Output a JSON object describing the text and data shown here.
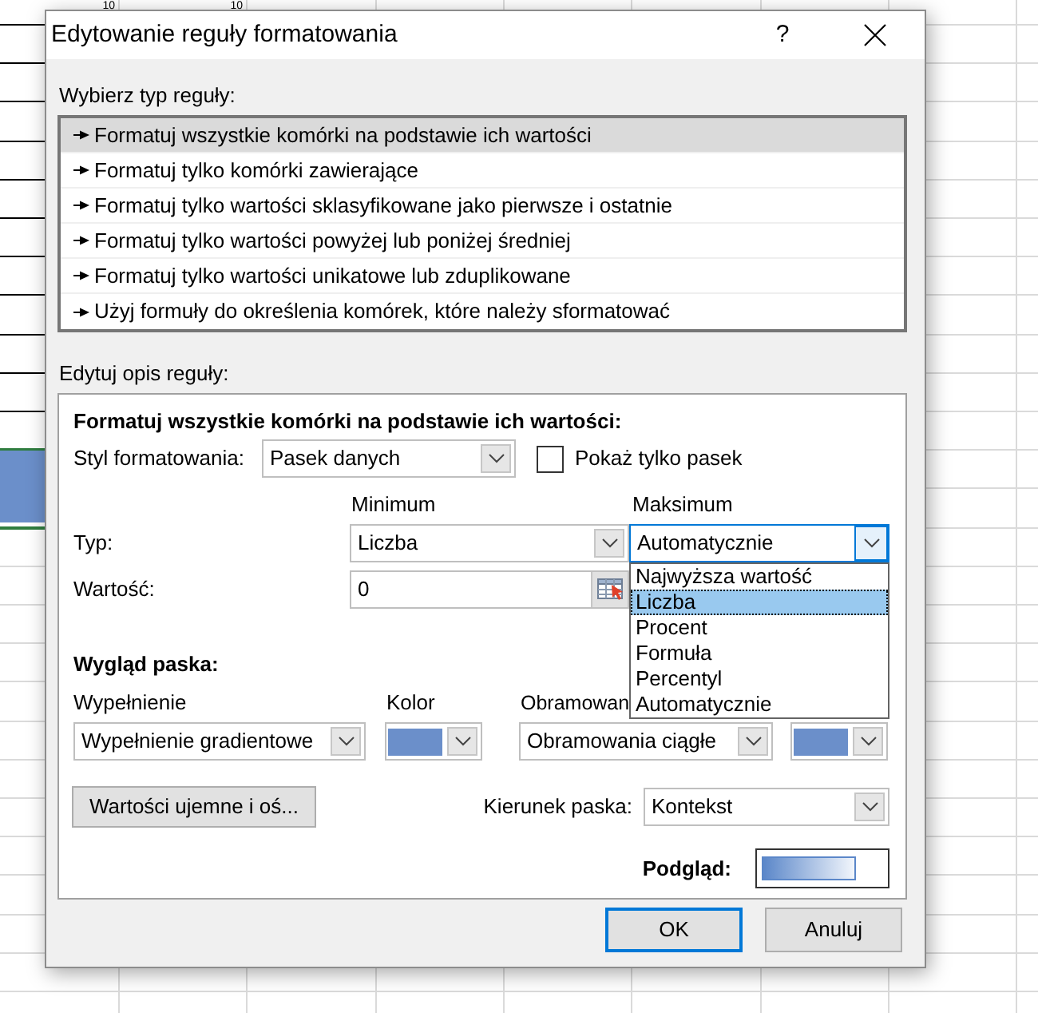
{
  "spreadsheet": {
    "top_row_values": [
      "10",
      "10"
    ]
  },
  "dialog": {
    "title": "Edytowanie reguły formatowania",
    "help_button": "?",
    "rule_type_label": "Wybierz typ reguły:",
    "rule_types": [
      {
        "label": "Formatuj wszystkie komórki na podstawie ich wartości",
        "selected": true
      },
      {
        "label": "Formatuj tylko komórki zawierające",
        "selected": false
      },
      {
        "label": "Formatuj tylko wartości sklasyfikowane jako pierwsze i ostatnie",
        "selected": false
      },
      {
        "label": "Formatuj tylko wartości powyżej lub poniżej średniej",
        "selected": false
      },
      {
        "label": "Formatuj tylko wartości unikatowe lub zduplikowane",
        "selected": false
      },
      {
        "label": "Użyj formuły do określenia komórek, które należy sformatować",
        "selected": false
      }
    ],
    "description_label": "Edytuj opis reguły:",
    "description": {
      "heading": "Formatuj wszystkie komórki na podstawie ich wartości:",
      "style_label": "Styl formatowania:",
      "style_value": "Pasek danych",
      "show_bar_only": {
        "label": "Pokaż tylko pasek",
        "checked": false
      },
      "type_label": "Typ:",
      "value_label": "Wartość:",
      "minimum": {
        "heading": "Minimum",
        "type": "Liczba",
        "value": "0"
      },
      "maximum": {
        "heading": "Maksimum",
        "type": "Automatycznie",
        "focused": true,
        "dropdown_open": true,
        "options": [
          {
            "label": "Najwyższa wartość",
            "selected": false
          },
          {
            "label": "Liczba",
            "selected": true
          },
          {
            "label": "Procent",
            "selected": false
          },
          {
            "label": "Formuła",
            "selected": false
          },
          {
            "label": "Percentyl",
            "selected": false
          },
          {
            "label": "Automatycznie",
            "selected": false
          }
        ]
      },
      "appearance_heading": "Wygląd paska:",
      "fill_label": "Wypełnienie",
      "fill_value": "Wypełnienie gradientowe",
      "color_label": "Kolor",
      "border_label": "Obramowan",
      "border_value": "Obramowania ciągłe",
      "negative_button": "Wartości ujemne i oś...",
      "direction_label": "Kierunek paska:",
      "direction_value": "Kontekst",
      "preview_label": "Podgląd:"
    },
    "buttons": [
      {
        "label": "OK",
        "default": true
      },
      {
        "label": "Anuluj",
        "default": false
      }
    ]
  }
}
